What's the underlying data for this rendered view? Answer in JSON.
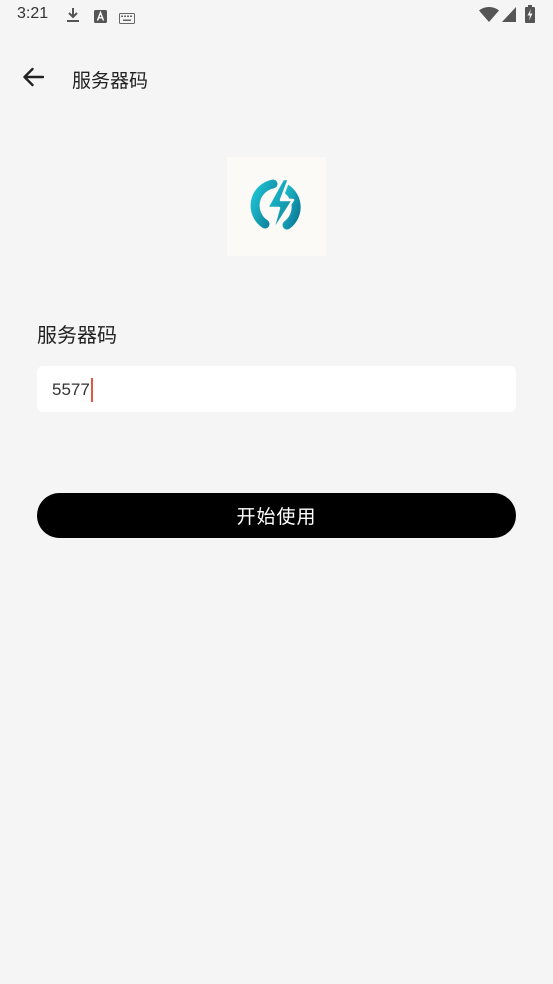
{
  "status_bar": {
    "time": "3:21",
    "left_icons": [
      "download-icon",
      "a-badge-icon",
      "keyboard-icon"
    ],
    "right_icons": [
      "wifi-icon",
      "cellular-signal-icon",
      "battery-charging-icon"
    ]
  },
  "app_bar": {
    "back_icon": "arrow-left-icon",
    "title": "服务器码"
  },
  "logo": {
    "icon": "lightning-bolt-logo",
    "colors": [
      "#19b3c9",
      "#0f7e9a"
    ]
  },
  "form": {
    "label": "服务器码",
    "input_value": "5577",
    "caret_color": "#e0593e"
  },
  "actions": {
    "start_label": "开始使用"
  },
  "colors": {
    "background": "#f5f5f5",
    "button_bg": "#000000",
    "button_text": "#ffffff"
  }
}
